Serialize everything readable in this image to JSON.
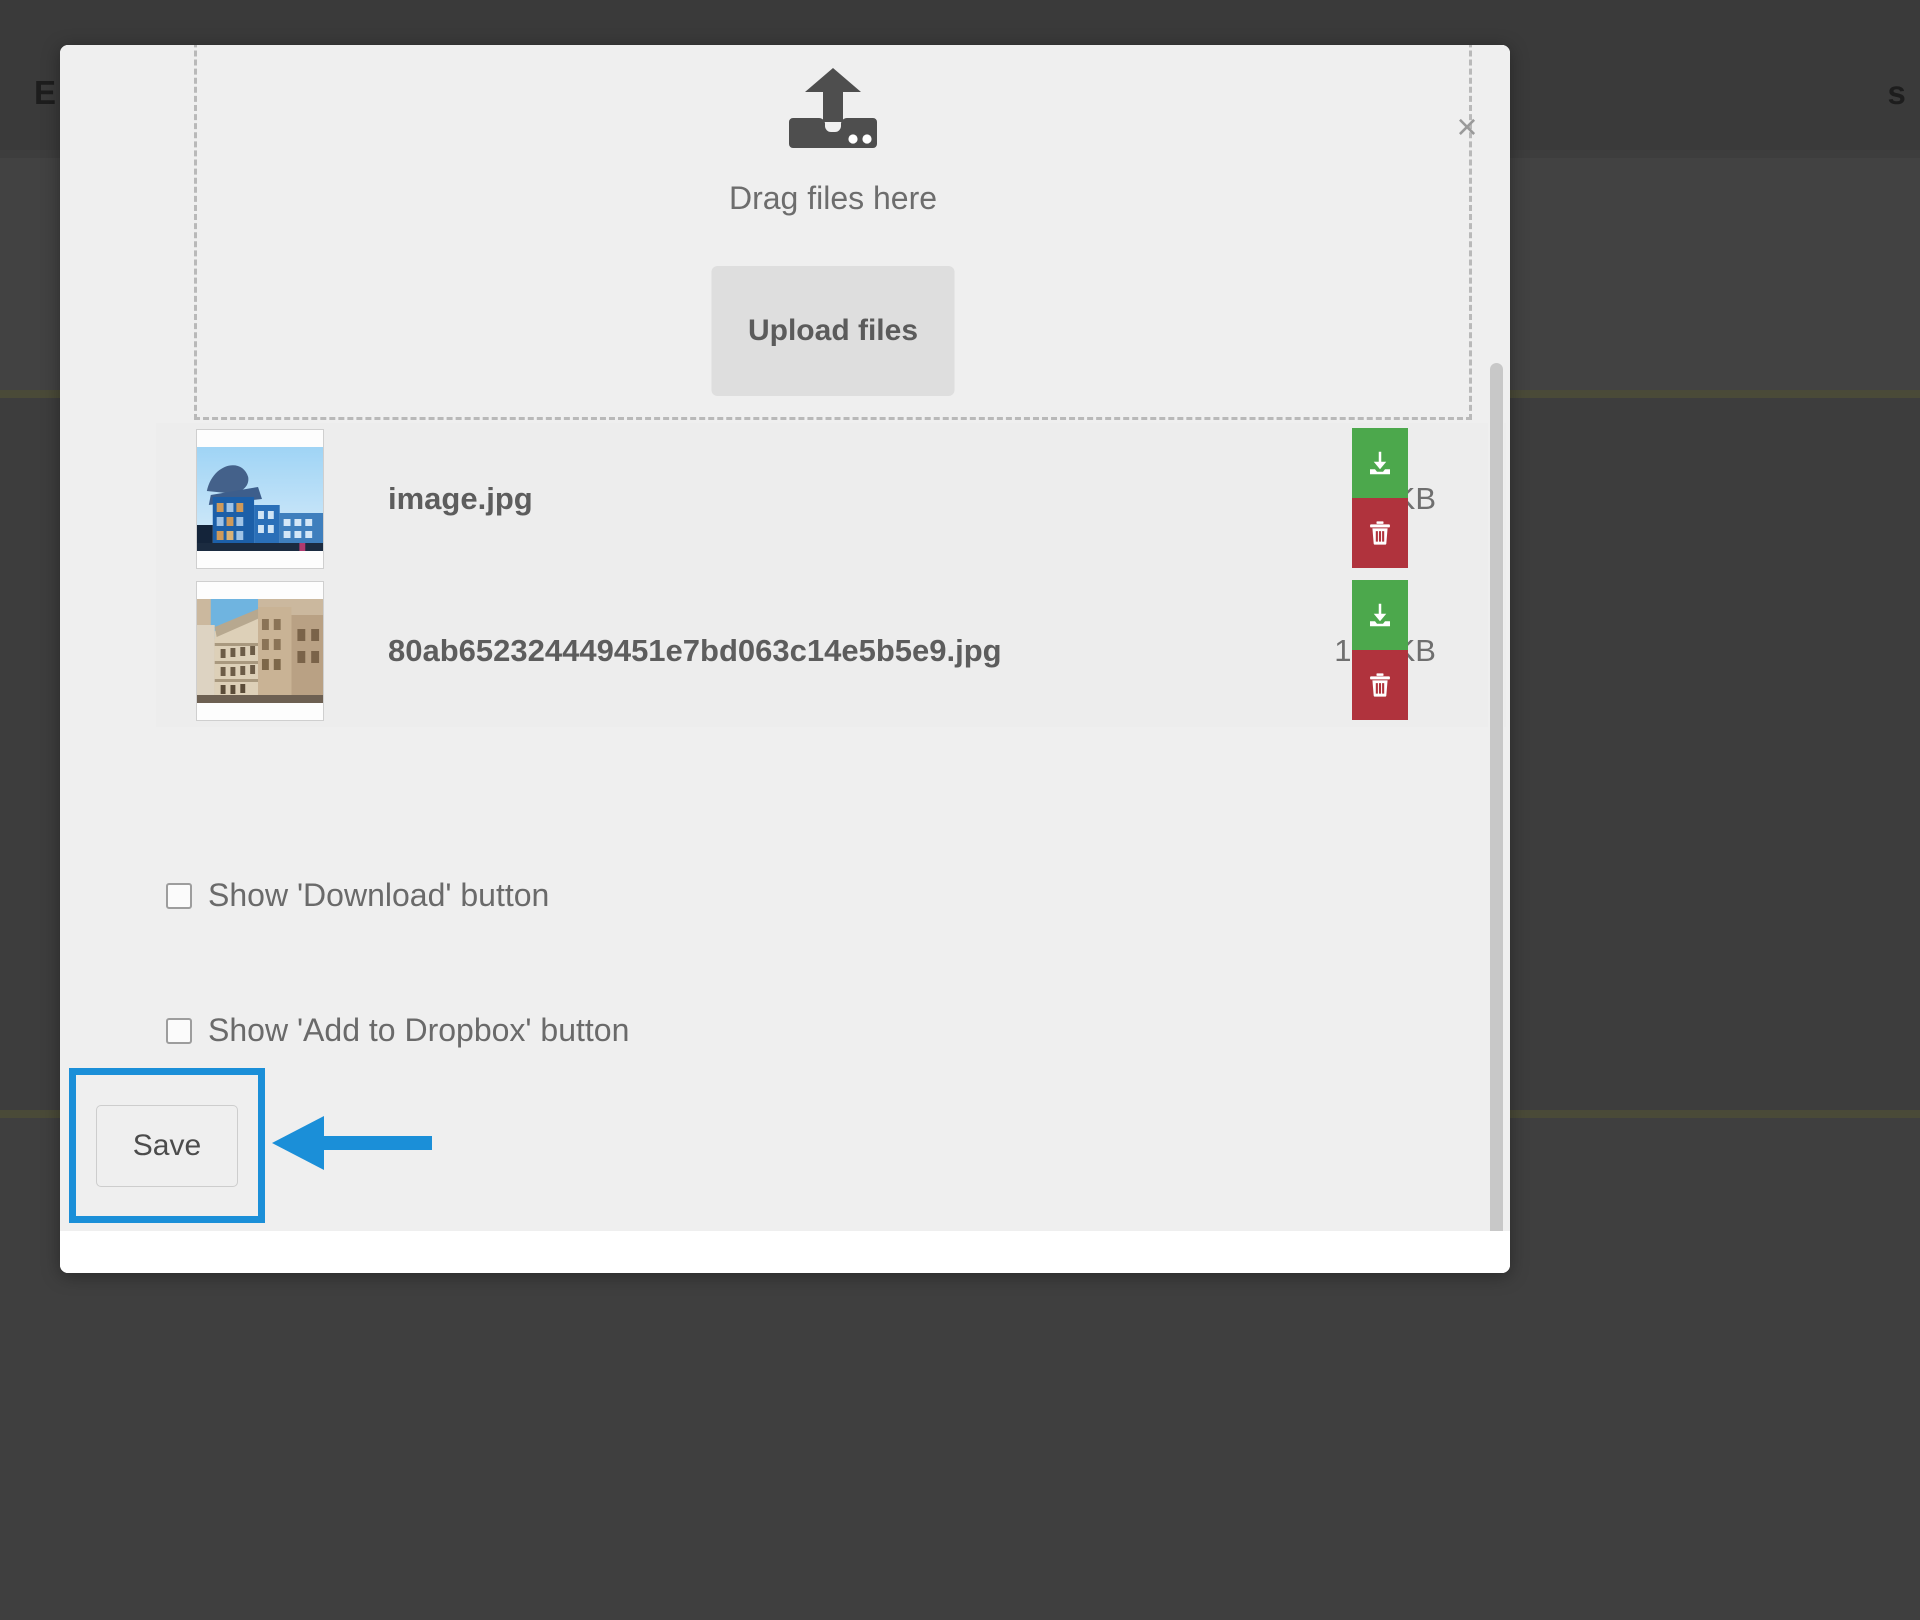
{
  "background": {
    "left_text": "E",
    "right_text": "s"
  },
  "modal": {
    "close_icon": "close-icon",
    "close_label": "×",
    "dropzone": {
      "icon": "upload-to-drive-icon",
      "drag_label": "Drag files here",
      "upload_button_label": "Upload files"
    },
    "files": [
      {
        "thumbnail_alt": "modern blue glass office building",
        "name": "image.jpg",
        "size": "19 KB",
        "download_icon": "download-icon",
        "delete_icon": "trash-icon"
      },
      {
        "thumbnail_alt": "beige classical european building",
        "name": "80ab652324449451e7bd063c14e5b5e9.jpg",
        "size": "188 KB",
        "download_icon": "download-icon",
        "delete_icon": "trash-icon"
      }
    ],
    "options": [
      {
        "label": "Show 'Download' button",
        "checked": false
      },
      {
        "label": "Show 'Add to Dropbox' button",
        "checked": false
      }
    ],
    "save_label": "Save"
  },
  "annotation": {
    "accent_color": "#1b8fd8",
    "target": "save-button"
  },
  "colors": {
    "download_green": "#4ca84c",
    "delete_red": "#b0333d",
    "annotation_blue": "#1b8fd8",
    "modal_bg": "#efefef"
  }
}
